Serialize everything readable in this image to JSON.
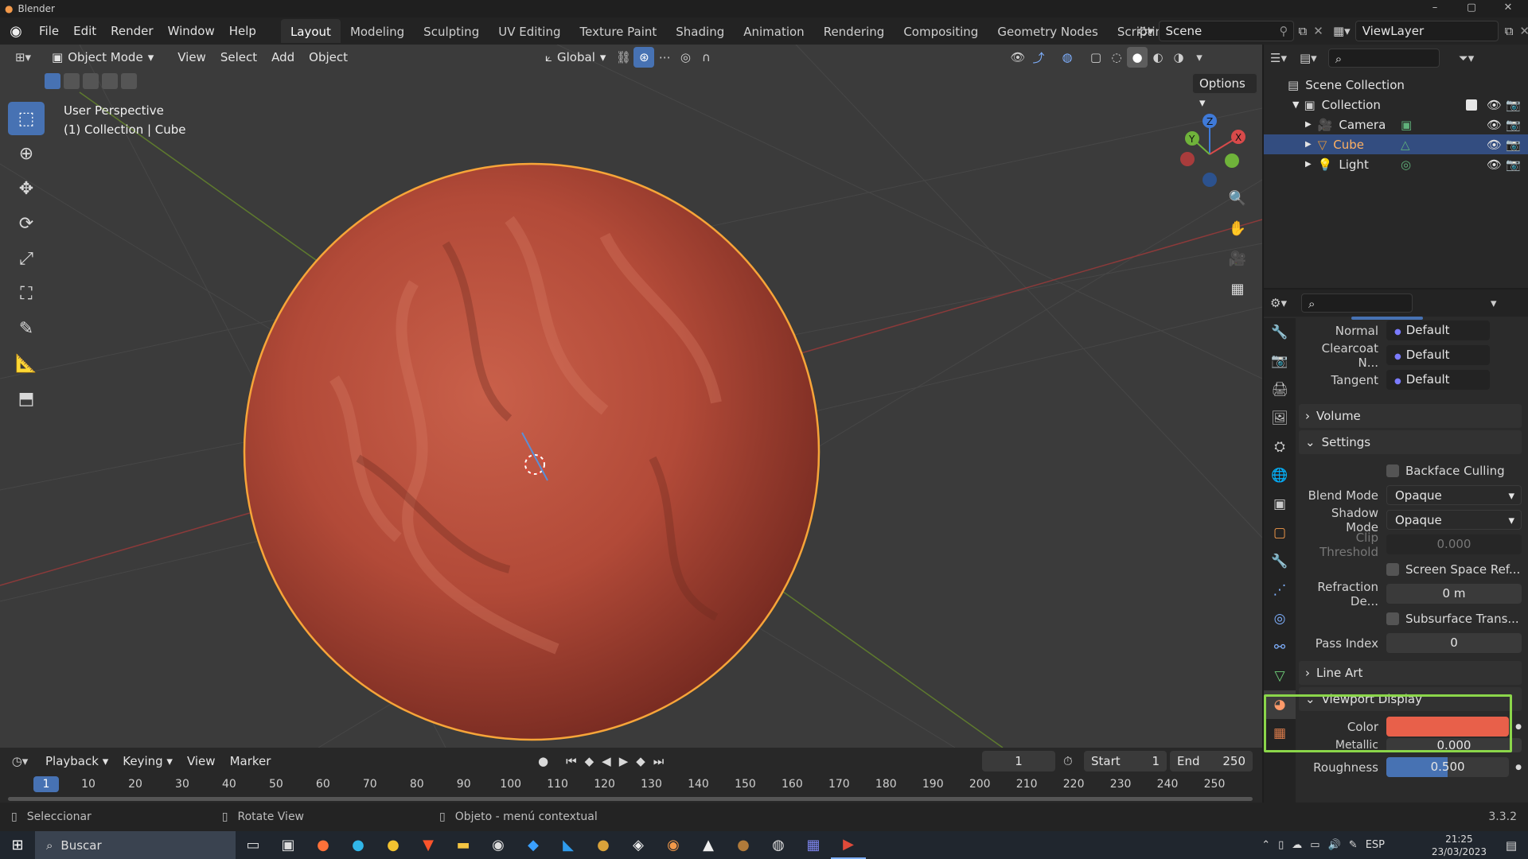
{
  "app": {
    "title": "Blender",
    "version": "3.3.2"
  },
  "menus": [
    "File",
    "Edit",
    "Render",
    "Window",
    "Help"
  ],
  "workspaces": [
    {
      "label": "Layout",
      "active": true
    },
    {
      "label": "Modeling"
    },
    {
      "label": "Sculpting"
    },
    {
      "label": "UV Editing"
    },
    {
      "label": "Texture Paint"
    },
    {
      "label": "Shading"
    },
    {
      "label": "Animation"
    },
    {
      "label": "Rendering"
    },
    {
      "label": "Compositing"
    },
    {
      "label": "Geometry Nodes"
    },
    {
      "label": "Scripting"
    }
  ],
  "scene": {
    "name": "Scene",
    "view_layer": "ViewLayer"
  },
  "viewport": {
    "mode": "Object Mode",
    "menus": [
      "View",
      "Select",
      "Add",
      "Object"
    ],
    "transform_orientation": "Global",
    "options_label": "Options",
    "perspective_label": "User Perspective",
    "context_label": "(1) Collection | Cube",
    "object_color": "#c0523e",
    "outline_color": "#f7a539",
    "gizmo": {
      "x": "X",
      "y": "Y",
      "z": "Z"
    }
  },
  "outliner": {
    "root": "Scene Collection",
    "collection": "Collection",
    "items": [
      {
        "label": "Camera",
        "icon": "camera-icon",
        "selected": false
      },
      {
        "label": "Cube",
        "icon": "mesh-icon",
        "selected": true
      },
      {
        "label": "Light",
        "icon": "light-icon",
        "selected": false
      }
    ]
  },
  "properties": {
    "rows_top": [
      {
        "label": "Normal",
        "value": "Default"
      },
      {
        "label": "Clearcoat N...",
        "value": "Default"
      },
      {
        "label": "Tangent",
        "value": "Default"
      }
    ],
    "panel_volume": "Volume",
    "panel_settings": "Settings",
    "backface_culling": "Backface Culling",
    "blend_mode_label": "Blend Mode",
    "blend_mode": "Opaque",
    "shadow_mode_label": "Shadow Mode",
    "shadow_mode": "Opaque",
    "clip_threshold_label": "Clip Threshold",
    "clip_threshold": "0.000",
    "screen_space_ref": "Screen Space Ref...",
    "refraction_label": "Refraction De...",
    "refraction_value": "0 m",
    "subsurface": "Subsurface Trans...",
    "pass_index_label": "Pass Index",
    "pass_index": "0",
    "panel_lineart": "Line Art",
    "panel_viewport_display": "Viewport Display",
    "color_label": "Color",
    "color_value": "#e8604a",
    "metallic_label": "Metallic",
    "metallic_value": "0.000",
    "roughness_label": "Roughness",
    "roughness_value": "0.500",
    "roughness_fraction": 0.5,
    "highlight_color": "#8bd64a"
  },
  "timeline": {
    "menus": [
      "Playback",
      "Keying",
      "View",
      "Marker"
    ],
    "current_frame": "1",
    "start_label": "Start",
    "start": "1",
    "end_label": "End",
    "end": "250",
    "ticks": [
      "1",
      "10",
      "20",
      "30",
      "40",
      "50",
      "60",
      "70",
      "80",
      "90",
      "100",
      "110",
      "120",
      "130",
      "140",
      "150",
      "160",
      "170",
      "180",
      "190",
      "200",
      "210",
      "220",
      "230",
      "240",
      "250"
    ]
  },
  "statusbar": {
    "select": "Seleccionar",
    "rotate": "Rotate View",
    "context_menu": "Objeto - menú contextual"
  },
  "taskbar": {
    "search": "Buscar",
    "lang": "ESP",
    "time": "21:25",
    "date": "23/03/2023"
  }
}
